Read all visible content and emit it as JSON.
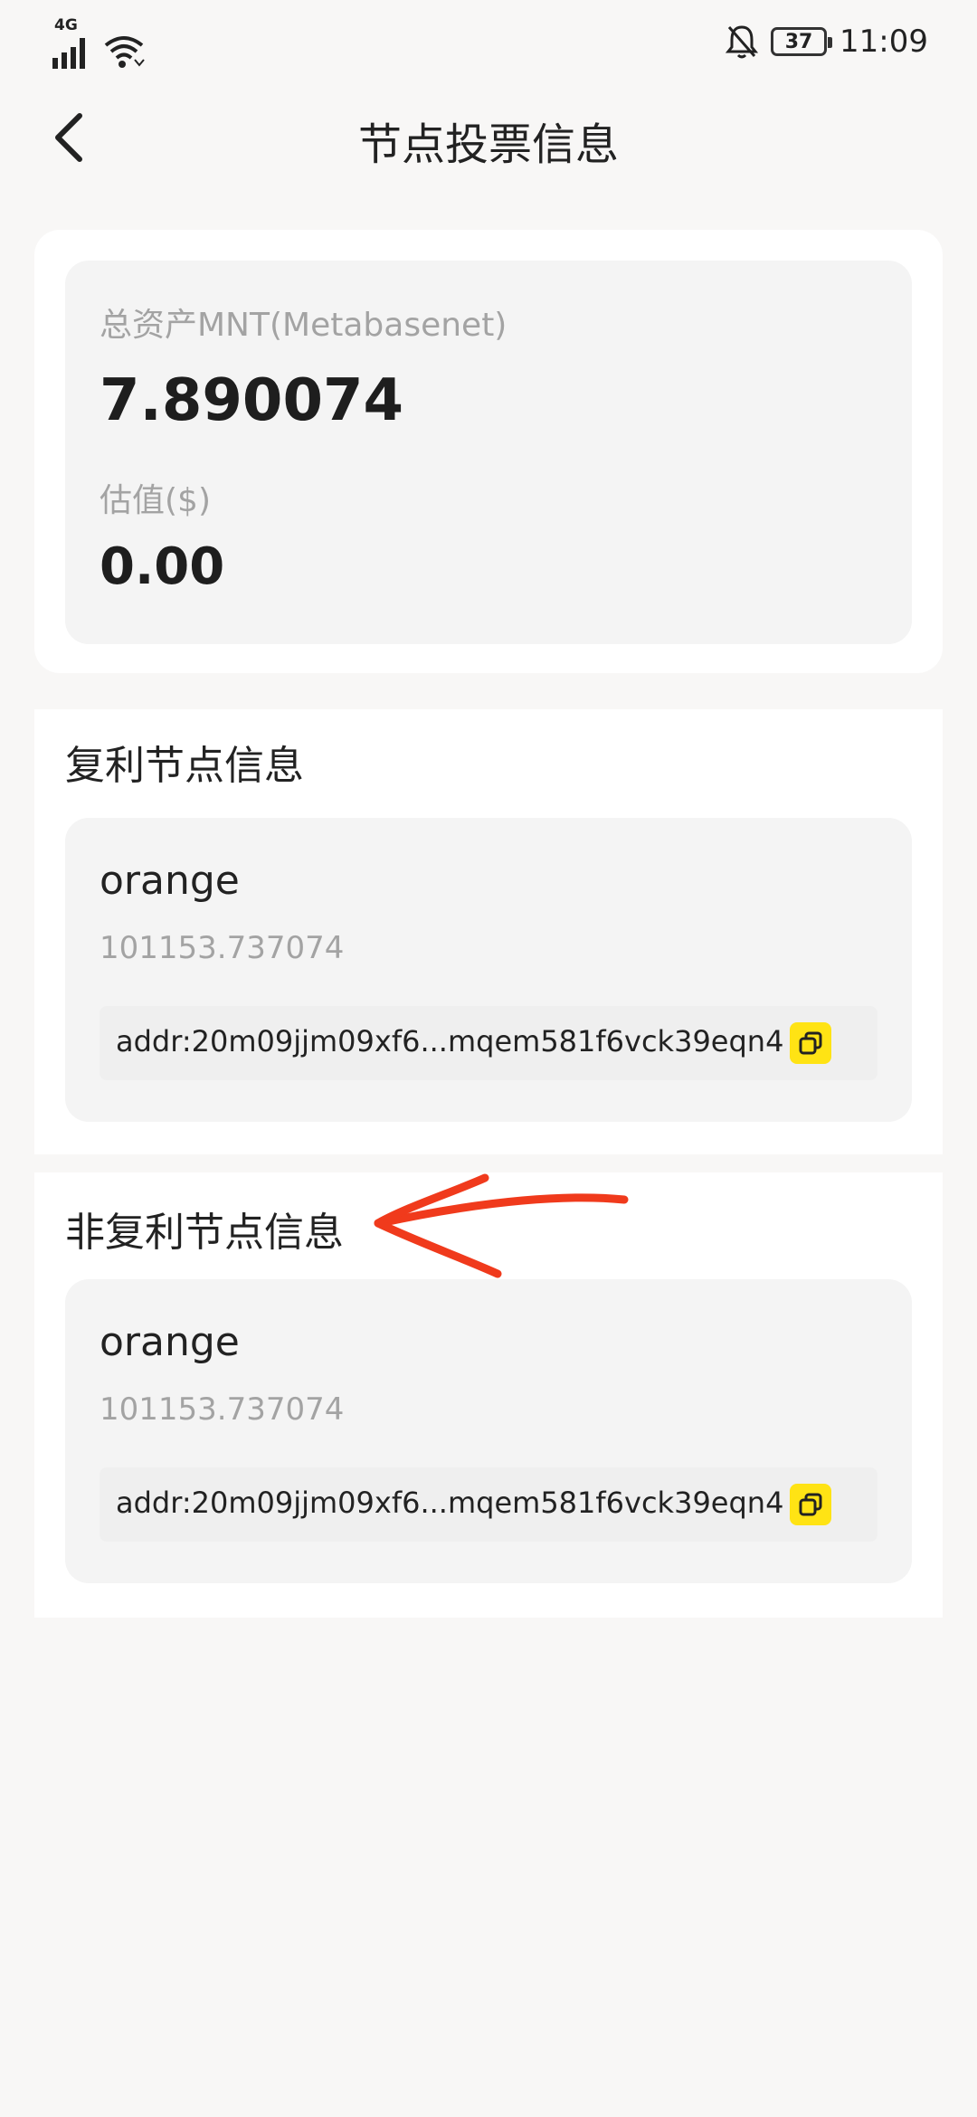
{
  "status_bar": {
    "network": "4G",
    "battery": "37",
    "time": "11:09"
  },
  "header": {
    "title": "节点投票信息",
    "back_icon": "chevron-left-icon"
  },
  "assets": {
    "total_label": "总资产MNT(Metabasenet)",
    "total_value": "7.890074",
    "valuation_label": "估值($)",
    "valuation_value": "0.00"
  },
  "compound_section": {
    "title": "复利节点信息",
    "node": {
      "name": "orange",
      "amount": "101153.737074",
      "address": "addr:20m09jjm09xf6...mqem581f6vck39eqn4"
    }
  },
  "non_compound_section": {
    "title": "非复利节点信息",
    "node": {
      "name": "orange",
      "amount": "101153.737074",
      "address": "addr:20m09jjm09xf6...mqem581f6vck39eqn4"
    }
  },
  "colors": {
    "background": "#f8f7f6",
    "card": "#f4f4f4",
    "copy_button": "#ffe314",
    "annotation": "#f03a1c"
  }
}
